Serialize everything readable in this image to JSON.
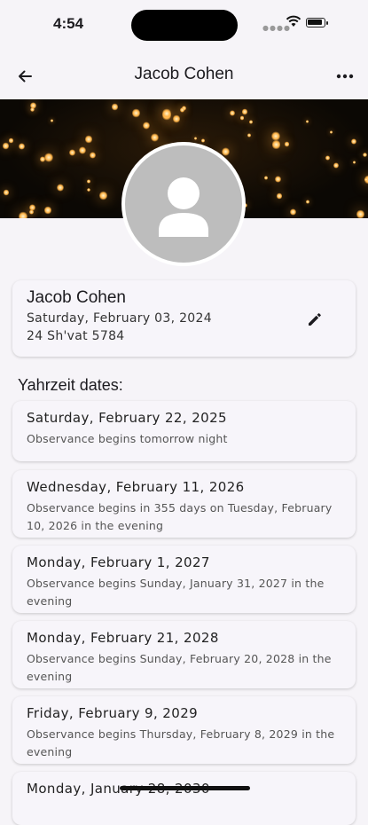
{
  "status_bar": {
    "time": "4:54"
  },
  "app_bar": {
    "title": "Jacob Cohen"
  },
  "profile": {
    "name": "Jacob Cohen",
    "gregorian_date": "Saturday, February 03, 2024",
    "hebrew_date": "24 Sh'vat 5784"
  },
  "section": {
    "title": "Yahrzeit dates:"
  },
  "yahrzeits": [
    {
      "date": "Saturday, February 22, 2025",
      "desc": "Observance begins tomorrow night"
    },
    {
      "date": "Wednesday, February 11, 2026",
      "desc": "Observance begins in 355 days on Tuesday, February 10, 2026 in the evening"
    },
    {
      "date": "Monday, February 1, 2027",
      "desc": "Observance begins Sunday, January 31, 2027 in the evening"
    },
    {
      "date": "Monday, February 21, 2028",
      "desc": "Observance begins Sunday, February 20, 2028 in the evening"
    },
    {
      "date": "Friday, February 9, 2029",
      "desc": "Observance begins Thursday, February 8, 2029 in the evening"
    },
    {
      "date": "Monday, January 28, 2030",
      "desc": ""
    }
  ],
  "icons": {
    "back": "arrow-left-icon",
    "more": "more-horizontal-icon",
    "edit": "pencil-icon",
    "avatar": "person-icon"
  },
  "colors": {
    "background": "#f6f4f8",
    "card": "#f7f5fa",
    "avatar": "#bdbdbd"
  }
}
